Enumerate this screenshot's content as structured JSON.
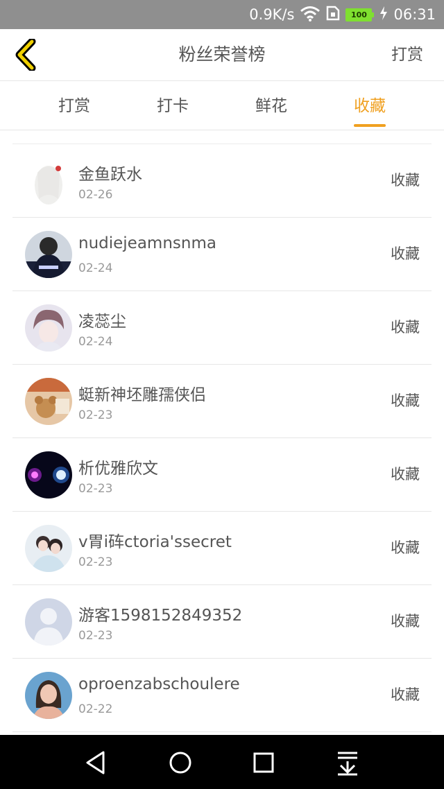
{
  "status_bar": {
    "speed": "0.9K/s",
    "battery": "100",
    "time": "06:31"
  },
  "header": {
    "title": "粉丝荣誉榜",
    "action": "打赏"
  },
  "tabs": [
    {
      "label": "打赏"
    },
    {
      "label": "打卡"
    },
    {
      "label": "鲜花"
    },
    {
      "label": "收藏",
      "active": true
    }
  ],
  "fans": [
    {
      "name": "金鱼跃水",
      "date": "02-26",
      "action": "收藏",
      "avatar": "anime-girl-white-hair"
    },
    {
      "name": "nudiejeamnsnma",
      "date": "02-24",
      "action": "收藏",
      "avatar": "person-black-shirt"
    },
    {
      "name": "凌蕊尘",
      "date": "02-24",
      "action": "收藏",
      "avatar": "anime-boy-red-hair"
    },
    {
      "name": "蜓新神坯雕孺侠侣",
      "date": "02-23",
      "action": "收藏",
      "avatar": "teddy-bear"
    },
    {
      "name": "析优雅欣文",
      "date": "02-23",
      "action": "收藏",
      "avatar": "glowing-lights"
    },
    {
      "name": "v胃i砗ctoria'ssecret",
      "date": "02-23",
      "action": "收藏",
      "avatar": "couple-photo"
    },
    {
      "name": "游客1598152849352",
      "date": "02-23",
      "action": "收藏",
      "avatar": "default-user"
    },
    {
      "name": "oproenzabschoulere",
      "date": "02-22",
      "action": "收藏",
      "avatar": "girl-portrait"
    }
  ],
  "colors": {
    "accent": "#f0a020",
    "text": "#555555",
    "subtext": "#999999"
  }
}
